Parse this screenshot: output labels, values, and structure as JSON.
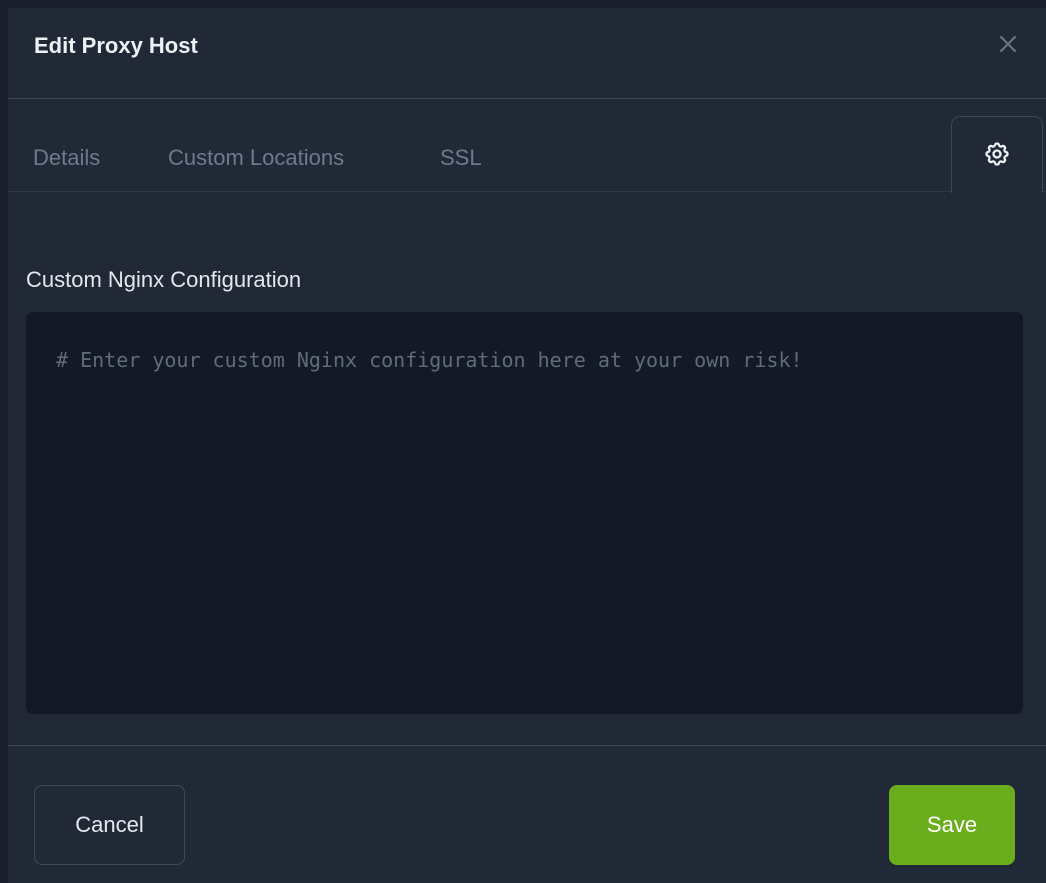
{
  "modal": {
    "title": "Edit Proxy Host"
  },
  "tabs": [
    {
      "label": "Details"
    },
    {
      "label": "Custom Locations"
    },
    {
      "label": "SSL"
    }
  ],
  "advanced": {
    "label": "Custom Nginx Configuration",
    "placeholder": "# Enter your custom Nginx configuration here at your own risk!",
    "value": ""
  },
  "footer": {
    "cancel_label": "Cancel",
    "save_label": "Save"
  },
  "icons": {
    "close": "close-icon",
    "advanced_tab": "gear-icon"
  },
  "colors": {
    "background": "#1a202b",
    "modal": "#212936",
    "editor": "#131a26",
    "accent_save": "#6aae1e"
  }
}
